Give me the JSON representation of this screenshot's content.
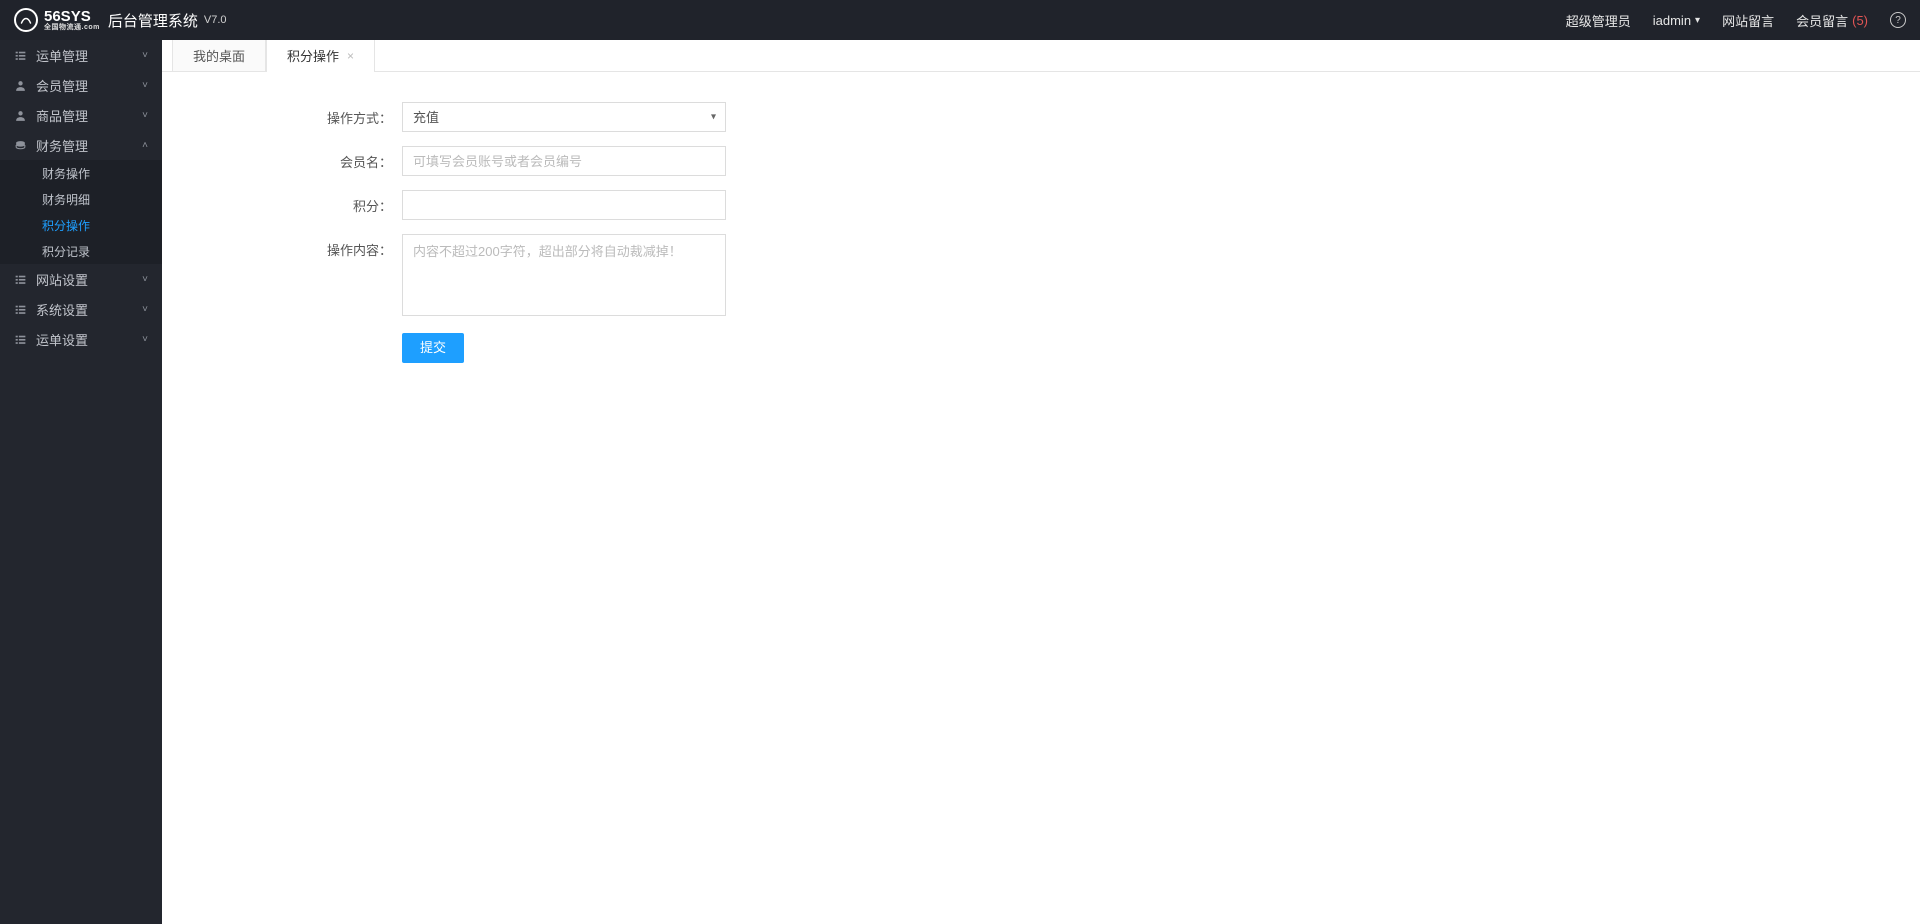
{
  "header": {
    "brand_text": "56SYS",
    "brand_sub": "全国物流通.com",
    "app_title": "后台管理系统",
    "app_version": "V7.0",
    "role_label": "超级管理员",
    "username": "iadmin",
    "site_msg": "网站留言",
    "member_msg": "会员留言",
    "member_msg_count": "(5)"
  },
  "sidebar": {
    "groups": [
      {
        "label": "运单管理",
        "icon": "list",
        "expanded": false
      },
      {
        "label": "会员管理",
        "icon": "user",
        "expanded": false
      },
      {
        "label": "商品管理",
        "icon": "user",
        "expanded": false
      },
      {
        "label": "财务管理",
        "icon": "coins",
        "expanded": true,
        "subs": [
          {
            "label": "财务操作",
            "active": false
          },
          {
            "label": "财务明细",
            "active": false
          },
          {
            "label": "积分操作",
            "active": true
          },
          {
            "label": "积分记录",
            "active": false
          }
        ]
      },
      {
        "label": "网站设置",
        "icon": "list",
        "expanded": false
      },
      {
        "label": "系统设置",
        "icon": "list",
        "expanded": false
      },
      {
        "label": "运单设置",
        "icon": "list",
        "expanded": false
      }
    ]
  },
  "tabs": [
    {
      "label": "我的桌面",
      "closable": false,
      "active": false
    },
    {
      "label": "积分操作",
      "closable": true,
      "active": true
    }
  ],
  "form": {
    "op_mode_label": "操作方式：",
    "op_mode_value": "充值",
    "member_label": "会员名：",
    "member_placeholder": "可填写会员账号或者会员编号",
    "points_label": "积分：",
    "content_label": "操作内容：",
    "content_placeholder": "内容不超过200字符，超出部分将自动裁减掉！",
    "submit_label": "提交"
  }
}
